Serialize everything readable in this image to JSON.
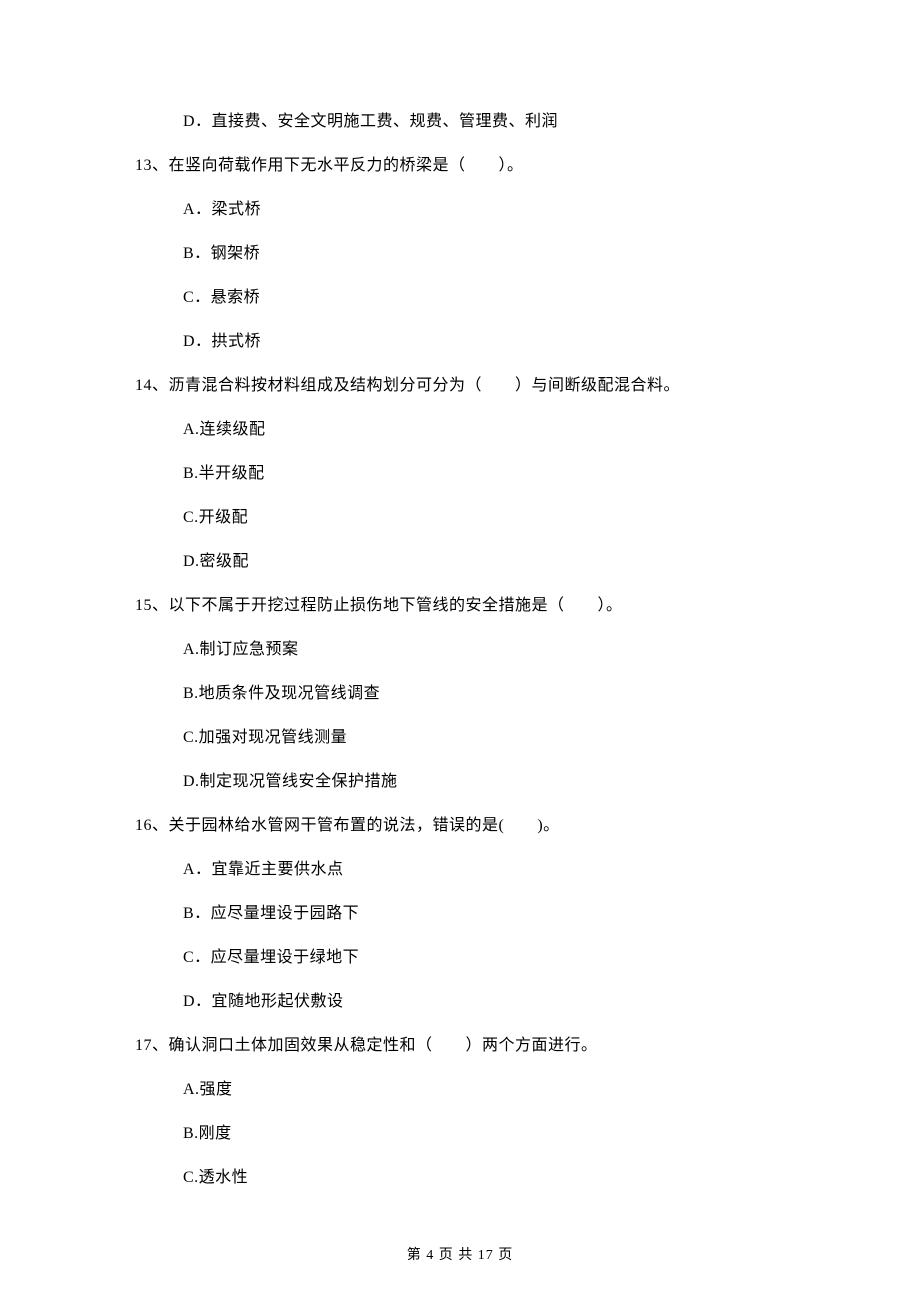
{
  "q12": {
    "options": {
      "d": "D．直接费、安全文明施工费、规费、管理费、利润"
    }
  },
  "q13": {
    "stem": "13、在竖向荷载作用下无水平反力的桥梁是（　　）。",
    "options": {
      "a": "A．梁式桥",
      "b": "B．钢架桥",
      "c": "C．悬索桥",
      "d": "D．拱式桥"
    }
  },
  "q14": {
    "stem": "14、沥青混合料按材料组成及结构划分可分为（　　）与间断级配混合料。",
    "options": {
      "a": "A.连续级配",
      "b": "B.半开级配",
      "c": "C.开级配",
      "d": "D.密级配"
    }
  },
  "q15": {
    "stem": "15、以下不属于开挖过程防止损伤地下管线的安全措施是（　　）。",
    "options": {
      "a": "A.制订应急预案",
      "b": "B.地质条件及现况管线调查",
      "c": "C.加强对现况管线测量",
      "d": "D.制定现况管线安全保护措施"
    }
  },
  "q16": {
    "stem": "16、关于园林给水管网干管布置的说法，错误的是(　　)。",
    "options": {
      "a": "A．宜靠近主要供水点",
      "b": "B．应尽量埋设于园路下",
      "c": "C．应尽量埋设于绿地下",
      "d": "D．宜随地形起伏敷设"
    }
  },
  "q17": {
    "stem": "17、确认洞口土体加固效果从稳定性和（　　）两个方面进行。",
    "options": {
      "a": "A.强度",
      "b": "B.刚度",
      "c": "C.透水性"
    }
  },
  "footer": "第 4 页 共 17 页"
}
